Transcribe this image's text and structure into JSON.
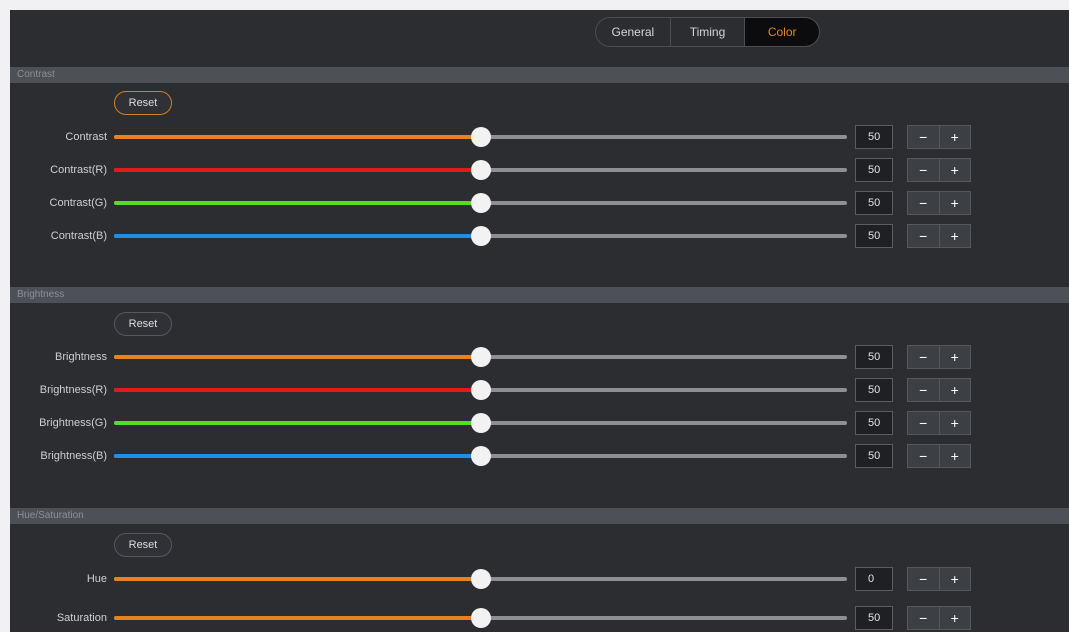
{
  "tabs": [
    {
      "label": "General",
      "active": false
    },
    {
      "label": "Timing",
      "active": false
    },
    {
      "label": "Color",
      "active": true
    }
  ],
  "colors": {
    "orange": "#e8821f",
    "red": "#e21a1a",
    "green": "#55dd22",
    "blue": "#1e8fe6"
  },
  "sections": [
    {
      "title": "Contrast",
      "reset_label": "Reset",
      "rows": [
        {
          "label": "Contrast",
          "value": "50",
          "color": "orange"
        },
        {
          "label": "Contrast(R)",
          "value": "50",
          "color": "red"
        },
        {
          "label": "Contrast(G)",
          "value": "50",
          "color": "green"
        },
        {
          "label": "Contrast(B)",
          "value": "50",
          "color": "blue"
        }
      ]
    },
    {
      "title": "Brightness",
      "reset_label": "Reset",
      "rows": [
        {
          "label": "Brightness",
          "value": "50",
          "color": "orange"
        },
        {
          "label": "Brightness(R)",
          "value": "50",
          "color": "red"
        },
        {
          "label": "Brightness(G)",
          "value": "50",
          "color": "green"
        },
        {
          "label": "Brightness(B)",
          "value": "50",
          "color": "blue"
        }
      ]
    },
    {
      "title": "Hue/Saturation",
      "reset_label": "Reset",
      "rows": [
        {
          "label": "Hue",
          "value": "0",
          "color": "orange"
        },
        {
          "label": "Saturation",
          "value": "50",
          "color": "orange"
        }
      ]
    }
  ],
  "stepper": {
    "minus": "−",
    "plus": "+"
  }
}
